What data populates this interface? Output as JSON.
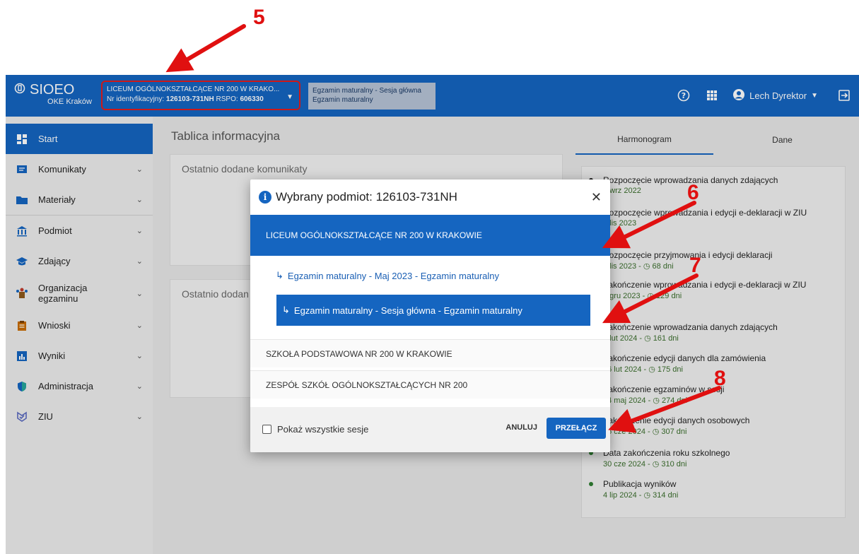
{
  "annotations": [
    "5",
    "6",
    "7",
    "8"
  ],
  "header": {
    "app_name": "SIOEO",
    "app_sub": "OKE Kraków",
    "selector_line1": "LICEUM OGÓLNOKSZTAŁCĄCE NR 200 W KRAKO...",
    "selector_line2_prefix": "Nr identyfikacyjny: ",
    "selector_id": "126103-731NH",
    "selector_rspo_prefix": " RSPO: ",
    "selector_rspo": "606330",
    "session_line1": "Egzamin maturalny - Sesja główna",
    "session_line2": "Egzamin maturalny",
    "user_name": "Lech Dyrektor",
    "icons": [
      "help-icon",
      "apps-grid-icon",
      "account-icon",
      "logout-icon"
    ]
  },
  "sidebar": {
    "items": [
      {
        "label": "Start",
        "icon": "dashboard-icon"
      },
      {
        "label": "Komunikaty",
        "icon": "message-icon"
      },
      {
        "label": "Materiały",
        "icon": "folder-icon"
      },
      {
        "label": "Podmiot",
        "icon": "institution-icon"
      },
      {
        "label": "Zdający",
        "icon": "graduation-cap-icon"
      },
      {
        "label": "Organizacja egzaminu",
        "icon": "organization-icon"
      },
      {
        "label": "Wnioski",
        "icon": "clipboard-icon"
      },
      {
        "label": "Wyniki",
        "icon": "bar-chart-icon"
      },
      {
        "label": "Administracja",
        "icon": "shield-icon"
      },
      {
        "label": "ZIU",
        "icon": "ziu-icon"
      }
    ]
  },
  "main": {
    "page_title": "Tablica informacyjna",
    "card1_title": "Ostatnio dodane komunikaty",
    "card2_title": "Ostatnio dodan",
    "tabs": [
      "Harmonogram",
      "Dane"
    ],
    "timeline": [
      {
        "title": "Rozpoczęcie wprowadzania danych zdających",
        "date": "1 wrz 2022",
        "days": ""
      },
      {
        "title": "Rozpoczęcie wprowadzania i edycji e-deklaracji w ZIU",
        "date": "1 lis 2023",
        "days": ""
      },
      {
        "title": "Rozpoczęcie przyjmowania i edycji deklaracji",
        "date": "1 lis 2023",
        "days": "68 dni"
      },
      {
        "title": "Zakończenie wprowadzania i edycji e-deklaracji w ZIU",
        "date": "1 gru 2023",
        "days": "129 dni"
      },
      {
        "title": "Zakończenie wprowadzania danych zdających",
        "date": "2 lut 2024",
        "days": "161 dni"
      },
      {
        "title": "Zakończenie edycji danych dla zamówienia",
        "date": "16 lut 2024",
        "days": "175 dni"
      },
      {
        "title": "Zakończenie egzaminów w sesji",
        "date": "24 maj 2024",
        "days": "274 dni"
      },
      {
        "title": "Zakończenie edycji danych osobowych",
        "date": "26 cze 2024",
        "days": "307 dni"
      },
      {
        "title": "Data zakończenia roku szkolnego",
        "date": "30 cze 2024",
        "days": "310 dni"
      },
      {
        "title": "Publikacja wyników",
        "date": "4 lip 2024",
        "days": "314 dni"
      }
    ]
  },
  "modal": {
    "title": "Wybrany podmiot: 126103-731NH",
    "selected_school": "LICEUM OGÓLNOKSZTAŁCĄCE NR 200 W KRAKOWIE",
    "exam_1": "Egzamin maturalny - Maj 2023 - Egzamin maturalny",
    "exam_2": "Egzamin maturalny - Sesja główna - Egzamin maturalny",
    "school_2": "SZKOŁA PODSTAWOWA NR 200 W KRAKOWIE",
    "school_3": "ZESPÓŁ SZKÓŁ OGÓLNOKSZTAŁCĄCYCH NR 200",
    "checkbox_label": "Pokaż wszystkie sesje",
    "cancel_label": "ANULUJ",
    "switch_label": "PRZEŁĄCZ"
  },
  "colors": {
    "primary": "#1565c0",
    "annotation": "#e01010",
    "accent_green": "#2e7d32"
  }
}
